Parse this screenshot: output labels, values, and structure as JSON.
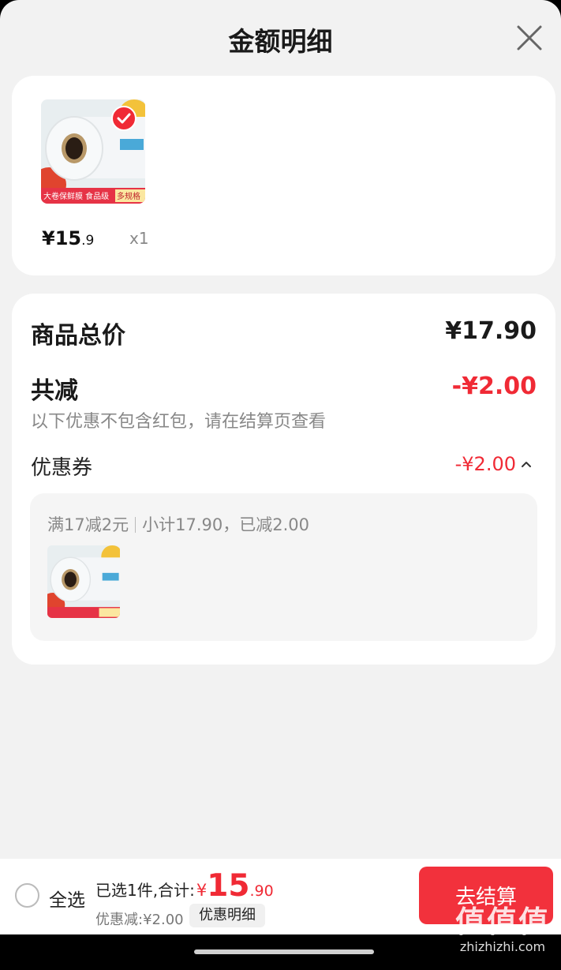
{
  "header": {
    "title": "金额明细"
  },
  "products": [
    {
      "price_int": "¥15",
      "price_dec": ".9",
      "qty": "x1",
      "banner_text": "大卷保鲜膜 食品级",
      "badge_text": "多规格"
    }
  ],
  "summary": {
    "total_label": "商品总价",
    "total_value": "¥17.90",
    "reduce_label": "共减",
    "reduce_value": "-¥2.00",
    "note": "以下优惠不包含红包，请在结算页查看",
    "coupon_label": "优惠券",
    "coupon_value": "-¥2.00",
    "coupon_rule": "满17减2元",
    "coupon_detail": "小计17.90，已减2.00"
  },
  "bottom": {
    "select_all": "全选",
    "selected_prefix": "已选1件,合计:",
    "yen": "¥",
    "total_int": "15",
    "total_dec": ".90",
    "discount": "优惠减:¥2.00",
    "detail_button": "优惠明细",
    "checkout_button": "去结算"
  },
  "watermark": {
    "big": "值值值",
    "small": "zhizhizhi.com"
  },
  "colors": {
    "accent": "#f02a35",
    "background": "#f2f2f2"
  }
}
